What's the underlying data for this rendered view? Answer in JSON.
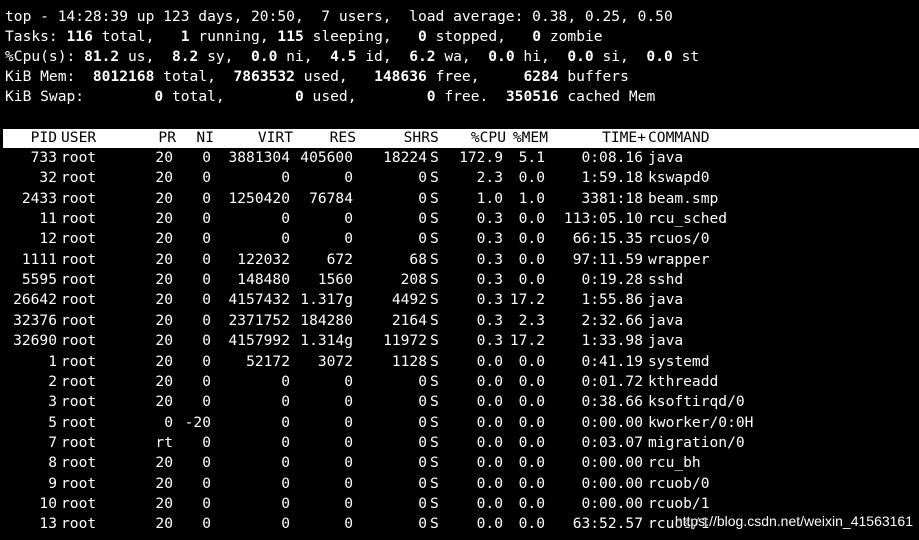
{
  "summary": {
    "l1_a": "top - 14:28:39 up 123 days, 20:50,  7 users,  load average: 0.38, 0.25, 0.50",
    "l2_a": "Tasks: ",
    "l2_total": "116",
    "l2_b": " total,   ",
    "l2_running": "1",
    "l2_c": " running, ",
    "l2_sleeping": "115",
    "l2_d": " sleeping,   ",
    "l2_stopped": "0",
    "l2_e": " stopped,   ",
    "l2_zombie": "0",
    "l2_f": " zombie",
    "l3_a": "%Cpu(s): ",
    "l3_us": "81.2",
    "l3_b": " us,  ",
    "l3_sy": "8.2",
    "l3_c": " sy,  ",
    "l3_ni": "0.0",
    "l3_d": " ni,  ",
    "l3_id": "4.5",
    "l3_e": " id,  ",
    "l3_wa": "6.2",
    "l3_f": " wa,  ",
    "l3_hi": "0.0",
    "l3_g": " hi,  ",
    "l3_si": "0.0",
    "l3_h": " si,  ",
    "l3_st": "0.0",
    "l3_i": " st",
    "l4_a": "KiB Mem:  ",
    "l4_total": "8012168",
    "l4_b": " total,  ",
    "l4_used": "7863532",
    "l4_c": " used,   ",
    "l4_free": "148636",
    "l4_d": " free,     ",
    "l4_buffers": "6284",
    "l4_e": " buffers",
    "l5_a": "KiB Swap:        ",
    "l5_total": "0",
    "l5_b": " total,        ",
    "l5_used": "0",
    "l5_c": " used,        ",
    "l5_free": "0",
    "l5_d": " free.  ",
    "l5_cached": "350516",
    "l5_e": " cached Mem"
  },
  "columns": [
    "PID",
    "USER",
    "PR",
    "NI",
    "VIRT",
    "RES",
    "SHR",
    "S",
    "%CPU",
    "%MEM",
    "TIME+",
    "COMMAND"
  ],
  "processes": [
    [
      "733",
      "root",
      "20",
      "0",
      "3881304",
      "405600",
      "18224",
      "S",
      "172.9",
      "5.1",
      "0:08.16",
      "java"
    ],
    [
      "32",
      "root",
      "20",
      "0",
      "0",
      "0",
      "0",
      "S",
      "2.3",
      "0.0",
      "1:59.18",
      "kswapd0"
    ],
    [
      "2433",
      "root",
      "20",
      "0",
      "1250420",
      "76784",
      "0",
      "S",
      "1.0",
      "1.0",
      "3381:18",
      "beam.smp"
    ],
    [
      "11",
      "root",
      "20",
      "0",
      "0",
      "0",
      "0",
      "S",
      "0.3",
      "0.0",
      "113:05.10",
      "rcu_sched"
    ],
    [
      "12",
      "root",
      "20",
      "0",
      "0",
      "0",
      "0",
      "S",
      "0.3",
      "0.0",
      "66:15.35",
      "rcuos/0"
    ],
    [
      "1111",
      "root",
      "20",
      "0",
      "122032",
      "672",
      "68",
      "S",
      "0.3",
      "0.0",
      "97:11.59",
      "wrapper"
    ],
    [
      "5595",
      "root",
      "20",
      "0",
      "148480",
      "1560",
      "208",
      "S",
      "0.3",
      "0.0",
      "0:19.28",
      "sshd"
    ],
    [
      "26642",
      "root",
      "20",
      "0",
      "4157432",
      "1.317g",
      "4492",
      "S",
      "0.3",
      "17.2",
      "1:55.86",
      "java"
    ],
    [
      "32376",
      "root",
      "20",
      "0",
      "2371752",
      "184280",
      "2164",
      "S",
      "0.3",
      "2.3",
      "2:32.66",
      "java"
    ],
    [
      "32690",
      "root",
      "20",
      "0",
      "4157992",
      "1.314g",
      "11972",
      "S",
      "0.3",
      "17.2",
      "1:33.98",
      "java"
    ],
    [
      "1",
      "root",
      "20",
      "0",
      "52172",
      "3072",
      "1128",
      "S",
      "0.0",
      "0.0",
      "0:41.19",
      "systemd"
    ],
    [
      "2",
      "root",
      "20",
      "0",
      "0",
      "0",
      "0",
      "S",
      "0.0",
      "0.0",
      "0:01.72",
      "kthreadd"
    ],
    [
      "3",
      "root",
      "20",
      "0",
      "0",
      "0",
      "0",
      "S",
      "0.0",
      "0.0",
      "0:38.66",
      "ksoftirqd/0"
    ],
    [
      "5",
      "root",
      "0",
      "-20",
      "0",
      "0",
      "0",
      "S",
      "0.0",
      "0.0",
      "0:00.00",
      "kworker/0:0H"
    ],
    [
      "7",
      "root",
      "rt",
      "0",
      "0",
      "0",
      "0",
      "S",
      "0.0",
      "0.0",
      "0:03.07",
      "migration/0"
    ],
    [
      "8",
      "root",
      "20",
      "0",
      "0",
      "0",
      "0",
      "S",
      "0.0",
      "0.0",
      "0:00.00",
      "rcu_bh"
    ],
    [
      "9",
      "root",
      "20",
      "0",
      "0",
      "0",
      "0",
      "S",
      "0.0",
      "0.0",
      "0:00.00",
      "rcuob/0"
    ],
    [
      "10",
      "root",
      "20",
      "0",
      "0",
      "0",
      "0",
      "S",
      "0.0",
      "0.0",
      "0:00.00",
      "rcuob/1"
    ],
    [
      "13",
      "root",
      "20",
      "0",
      "0",
      "0",
      "0",
      "S",
      "0.0",
      "0.0",
      "63:52.57",
      "rcuos/1"
    ]
  ],
  "watermark": "https://blog.csdn.net/weixin_41563161",
  "colors": {
    "background": "#000000",
    "text": "#ffffff",
    "header_bg": "#ffffff",
    "header_text": "#000000"
  }
}
